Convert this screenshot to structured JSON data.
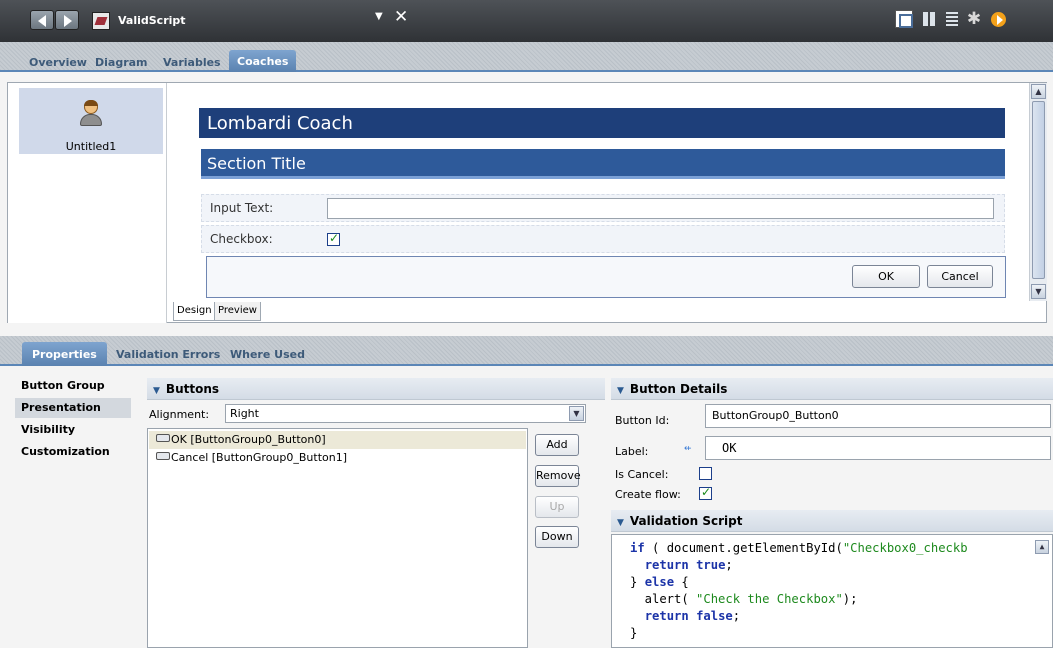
{
  "window": {
    "title": "ValidScript"
  },
  "editor_tabs": [
    "Overview",
    "Diagram",
    "Variables",
    "Coaches"
  ],
  "palette": {
    "items": [
      {
        "label": "Untitled1"
      }
    ]
  },
  "coach": {
    "title": "Lombardi Coach",
    "section_title": "Section Title",
    "input_label": "Input Text:",
    "input_value": "",
    "checkbox_label": "Checkbox:",
    "checkbox_checked": true,
    "ok_label": "OK",
    "cancel_label": "Cancel"
  },
  "mode_tabs": [
    "Design",
    "Preview"
  ],
  "properties_tabs": [
    "Properties",
    "Validation Errors",
    "Where Used"
  ],
  "sidebar": [
    "Button Group",
    "Presentation",
    "Visibility",
    "Customization"
  ],
  "buttons_section": {
    "title": "Buttons",
    "alignment_label": "Alignment:",
    "alignment_value": "Right",
    "items": [
      "OK [ButtonGroup0_Button0]",
      "Cancel [ButtonGroup0_Button1]"
    ],
    "add_label": "Add",
    "remove_label": "Remove",
    "up_label": "Up",
    "down_label": "Down"
  },
  "details": {
    "title": "Button Details",
    "id_label": "Button Id:",
    "id_value": "ButtonGroup0_Button0",
    "label_label": "Label:",
    "label_value": "OK",
    "cancel_label": "Is Cancel:",
    "is_cancel": false,
    "flow_label": "Create flow:",
    "create_flow": true
  },
  "validation": {
    "title": "Validation Script",
    "code": [
      "if ( document.getElementById(\"Checkbox0_checkb",
      "  return true;",
      "} else {",
      "  alert( \"Check the Checkbox\");",
      "  return false;",
      "}"
    ]
  },
  "colors": {
    "accent": "#5a82b0",
    "coach_title_bg": "#1e3f7a",
    "section_bg": "#2e5a9a"
  }
}
